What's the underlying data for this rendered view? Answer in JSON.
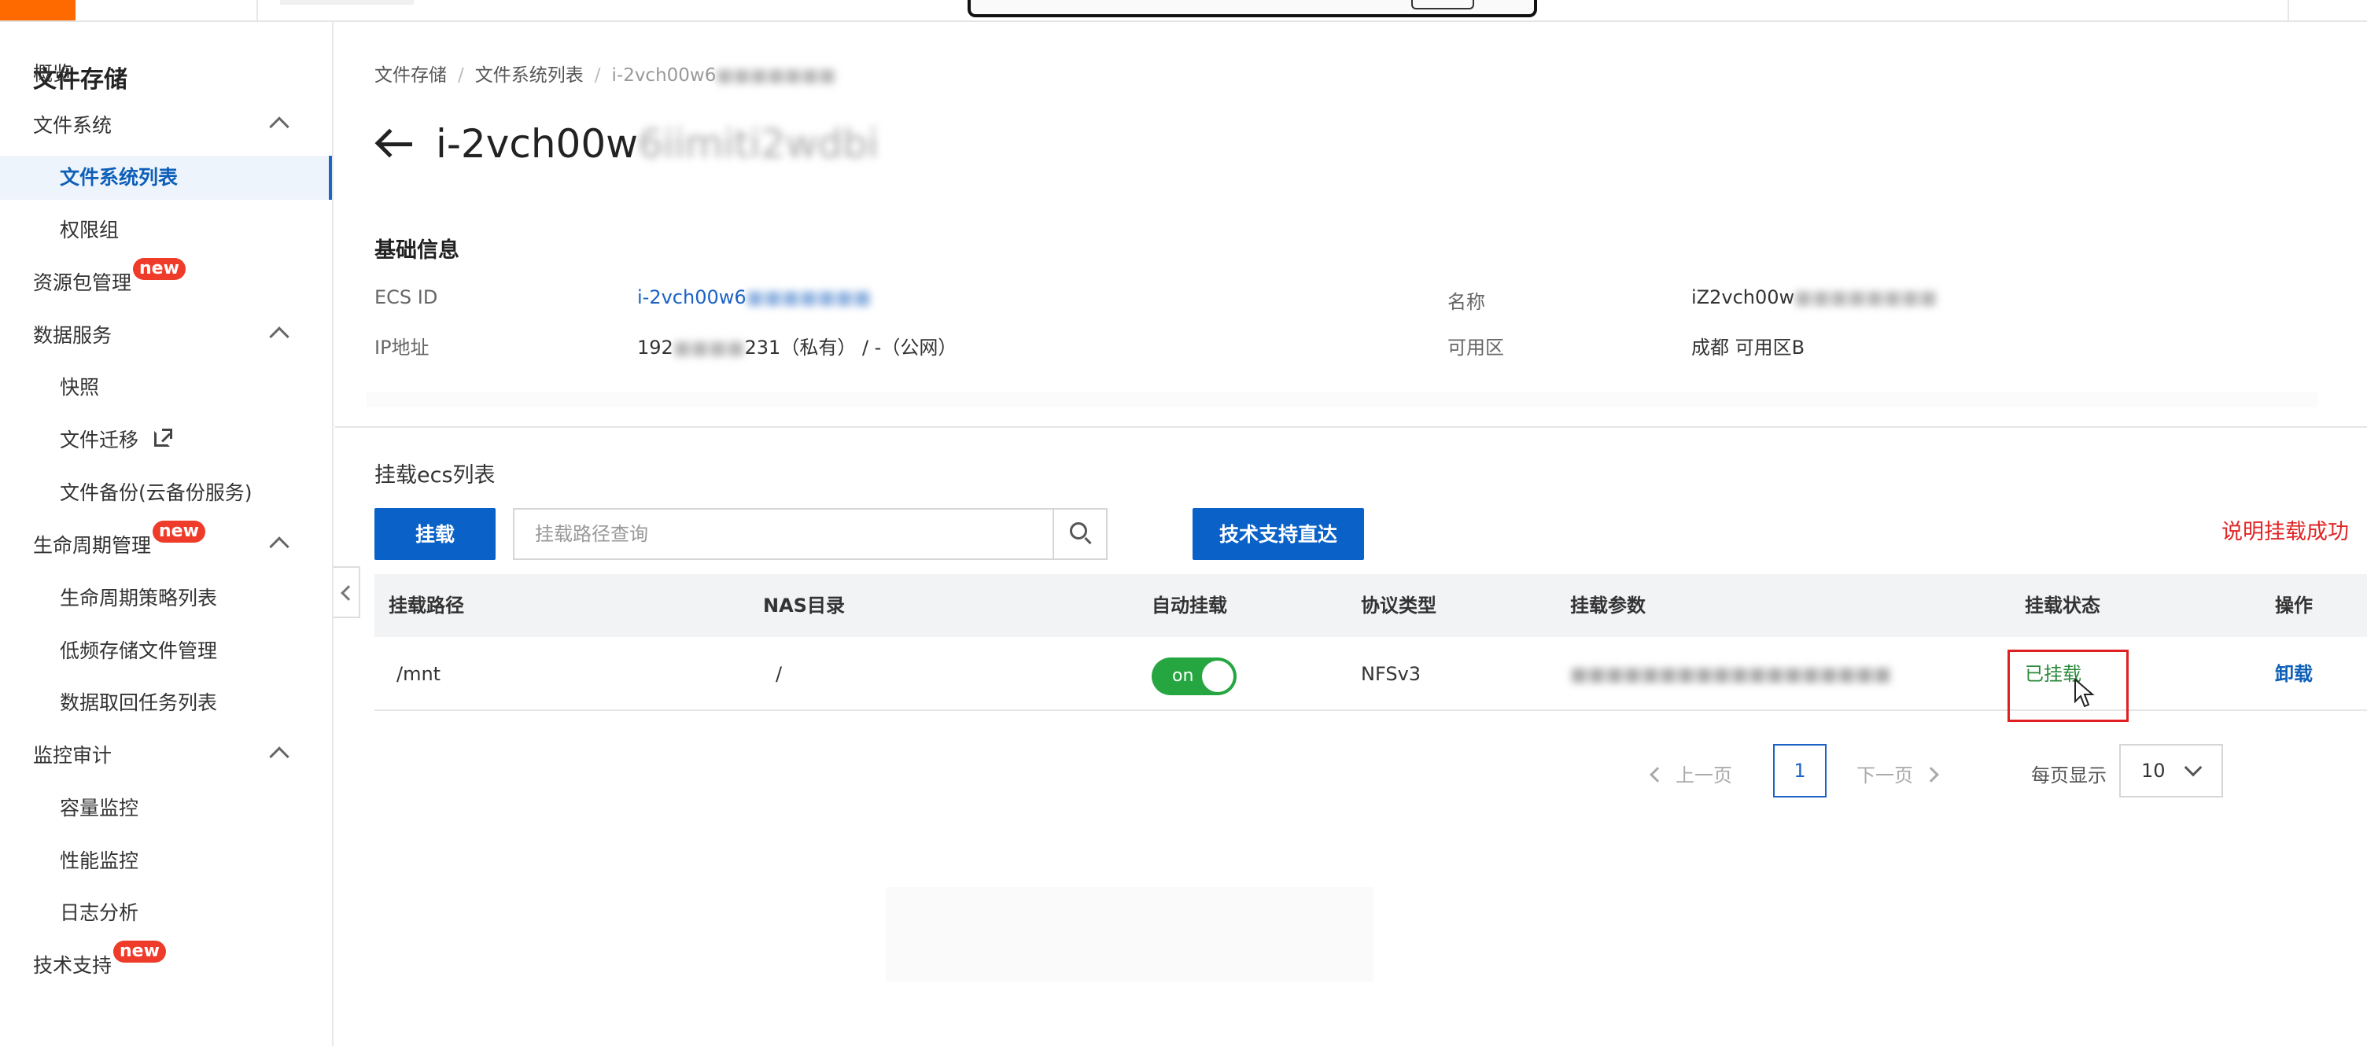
{
  "sidebar": {
    "title": "文件存储",
    "items": [
      {
        "label": "概览"
      },
      {
        "label": "文件系统"
      },
      {
        "label": "文件系统列表"
      },
      {
        "label": "权限组"
      },
      {
        "label": "资源包管理",
        "badge": "new"
      },
      {
        "label": "数据服务"
      },
      {
        "label": "快照"
      },
      {
        "label": "文件迁移"
      },
      {
        "label": "文件备份(云备份服务)"
      },
      {
        "label": "生命周期管理",
        "badge": "new"
      },
      {
        "label": "生命周期策略列表"
      },
      {
        "label": "低频存储文件管理"
      },
      {
        "label": "数据取回任务列表"
      },
      {
        "label": "监控审计"
      },
      {
        "label": "容量监控"
      },
      {
        "label": "性能监控"
      },
      {
        "label": "日志分析"
      },
      {
        "label": "技术支持",
        "badge": "new"
      }
    ]
  },
  "breadcrumb": {
    "root": "文件存储",
    "list": "文件系统列表",
    "current_visible": "i-2vch00w6",
    "current_obscured": "■■■■■■■"
  },
  "page": {
    "title_visible": "i-2vch00w",
    "title_obscured": "6iimiti2wdbi"
  },
  "basic_info": {
    "section_title": "基础信息",
    "ecs_id_label": "ECS ID",
    "ecs_id_visible": "i-2vch00w6",
    "ecs_id_obscured": "■■■■■■■",
    "ip_label": "IP地址",
    "ip_prefix": "192",
    "ip_obscured": "■■■■",
    "ip_suffix": "231（私有） / -（公网）",
    "name_label": "名称",
    "name_visible": "iZ2vch00w",
    "name_obscured": "■■■■■■■■",
    "zone_label": "可用区",
    "zone_value": "成都 可用区B"
  },
  "mount_list": {
    "title": "挂载ecs列表",
    "mount_button": "挂载",
    "search_placeholder": "挂载路径查询",
    "support_button": "技术支持直达",
    "annotation": "说明挂载成功",
    "columns": [
      "挂载路径",
      "NAS目录",
      "自动挂载",
      "协议类型",
      "挂载参数",
      "挂载状态",
      "操作"
    ],
    "rows": [
      {
        "path": "/mnt",
        "nas_dir": "/",
        "auto_mount": "on",
        "protocol": "NFSv3",
        "params_obscured": "■■■■■■■■■■■■■■■■■■",
        "status": "已挂载",
        "action": "卸载"
      }
    ]
  },
  "pagination": {
    "prev": "上一页",
    "current_page": "1",
    "next": "下一页",
    "per_page_label": "每页显示",
    "per_page_value": "10"
  },
  "colors": {
    "accent": "#0a62c8",
    "brand": "#ff6a00",
    "success": "#25a640",
    "annotation": "#e02525",
    "badge": "#ef3b2a"
  }
}
